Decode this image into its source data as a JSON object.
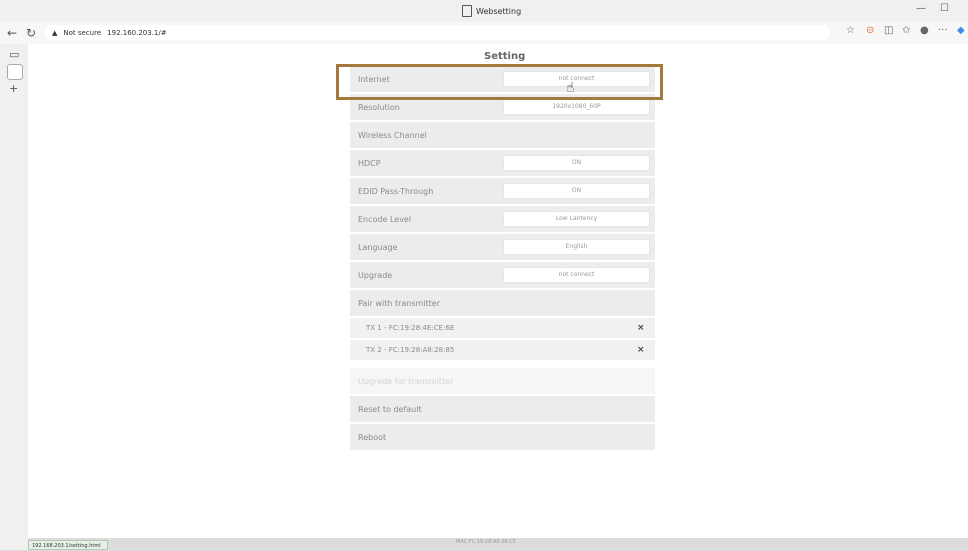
{
  "browser": {
    "tab_title": "Websetting",
    "url_warning": "Not secure",
    "url": "192.160.203.1/#",
    "minimize_glyph": "—",
    "maximize_glyph": "☐",
    "back_glyph": "←",
    "reload_glyph": "↻"
  },
  "page": {
    "heading": "Setting",
    "status_bar_url": "192.168.203.1/setting.html",
    "mac_footer": "MAC:FC:19:28:A8:28:C5"
  },
  "settings": {
    "internet": {
      "label": "Internet",
      "value": "not connect"
    },
    "resolution": {
      "label": "Resolution",
      "value": "1920x1080_60P"
    },
    "wireless_channel": {
      "label": "Wireless Channel"
    },
    "hdcp": {
      "label": "HDCP",
      "value": "ON"
    },
    "edid": {
      "label": "EDID Pass-Through",
      "value": "ON"
    },
    "encode_level": {
      "label": "Encode Level",
      "value": "Low Lantency"
    },
    "language": {
      "label": "Language",
      "value": "English"
    },
    "upgrade": {
      "label": "Upgrade",
      "value": "not connect"
    },
    "pair_header": {
      "label": "Pair with transmitter"
    },
    "tx": [
      {
        "label": "TX 1 - FC:19:28:4E:CE:6E",
        "remove": "×"
      },
      {
        "label": "TX 2 - FC:19:28:A8:28:85",
        "remove": "×"
      }
    ],
    "upgrade_tx": {
      "label": "Upgrade for transmitter"
    },
    "reset": {
      "label": "Reset to default"
    },
    "reboot": {
      "label": "Reboot"
    }
  },
  "icons": {
    "star": "☆",
    "more": "···",
    "plus": "+",
    "cursor": "☝"
  },
  "colors": {
    "highlight_border": "#a47a3c",
    "row_bg": "#ececec",
    "label_text": "#8a8a8a"
  }
}
